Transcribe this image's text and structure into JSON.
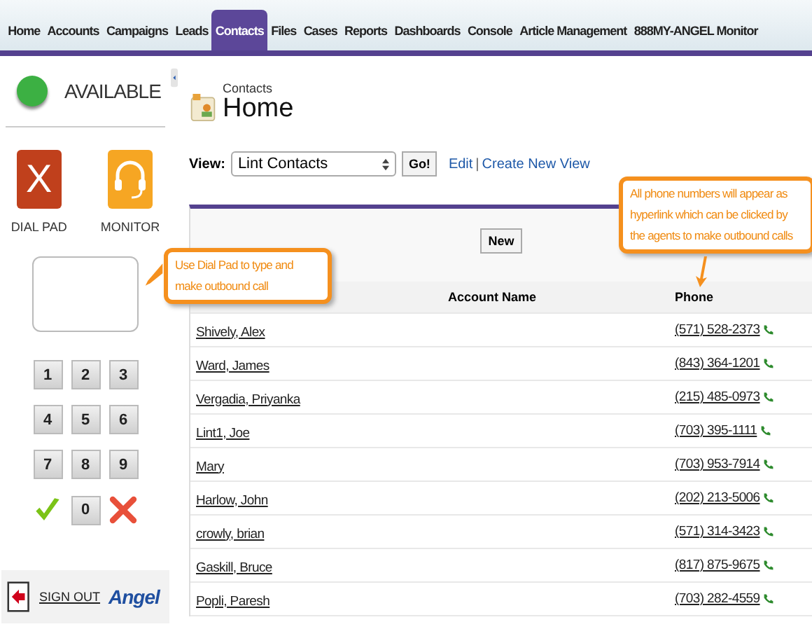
{
  "tabs": [
    {
      "label": "Home",
      "selected": false
    },
    {
      "label": "Accounts",
      "selected": false
    },
    {
      "label": "Campaigns",
      "selected": false
    },
    {
      "label": "Leads",
      "selected": false
    },
    {
      "label": "Contacts",
      "selected": true
    },
    {
      "label": "Files",
      "selected": false
    },
    {
      "label": "Cases",
      "selected": false
    },
    {
      "label": "Reports",
      "selected": false
    },
    {
      "label": "Dashboards",
      "selected": false
    },
    {
      "label": "Console",
      "selected": false
    },
    {
      "label": "Article Management",
      "selected": false
    },
    {
      "label": "888MY-ANGEL Monitor",
      "selected": false
    }
  ],
  "agent_panel": {
    "status": {
      "label": "AVAILABLE",
      "color": "#3cb043"
    },
    "modes": [
      {
        "kind": "dialpad",
        "label": "DIAL PAD",
        "glyph": "X"
      },
      {
        "kind": "monitor",
        "label": "MONITOR"
      }
    ],
    "keys": [
      "1",
      "2",
      "3",
      "4",
      "5",
      "6",
      "7",
      "8",
      "9"
    ],
    "bottom_row": [
      {
        "kind": "call"
      },
      {
        "kind": "key",
        "label": "0"
      },
      {
        "kind": "hangup"
      }
    ],
    "sign_out": "SIGN OUT",
    "brand": "Angel"
  },
  "page": {
    "breadcrumb": "Contacts",
    "title": "Home",
    "view_label": "View:",
    "view_value": "Lint Contacts",
    "go": "Go!",
    "edit": "Edit",
    "separator": "|",
    "create_view": "Create New View",
    "new_button": "New"
  },
  "table": {
    "columns": [
      "Account Name",
      "Phone"
    ],
    "rows": [
      {
        "name": "Shively, Alex",
        "phone": "(571) 528-2373"
      },
      {
        "name": "Ward, James",
        "phone": "(843) 364-1201"
      },
      {
        "name": "Vergadia, Priyanka",
        "phone": "(215) 485-0973"
      },
      {
        "name": "Lint1, Joe",
        "phone": "(703) 395-1111"
      },
      {
        "name": "Mary",
        "phone": "(703) 953-7914"
      },
      {
        "name": "Harlow, John",
        "phone": "(202) 213-5006"
      },
      {
        "name": "crowly, brian",
        "phone": "(571) 314-3423"
      },
      {
        "name": "Gaskill, Bruce",
        "phone": "(817) 875-9675"
      },
      {
        "name": "Popli, Paresh",
        "phone": "(703) 282-4559"
      }
    ]
  },
  "callouts": [
    {
      "kind": "dialpad",
      "text": "Use Dial Pad to type and make outbound call"
    },
    {
      "kind": "phone",
      "text": "All phone numbers will appear as hyperlink which can be clicked by the agents to make outbound calls"
    }
  ]
}
